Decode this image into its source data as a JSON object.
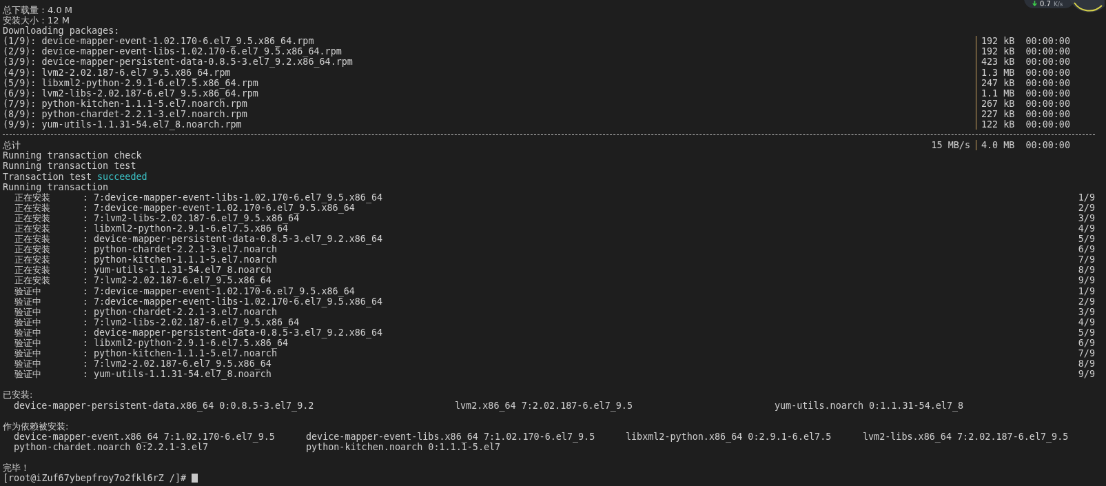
{
  "net_widget": {
    "speed": "0.7",
    "unit": "K/s"
  },
  "summary": [
    {
      "label": "总下载量：",
      "value": "4.0 M"
    },
    {
      "label": "安装大小：",
      "value": "12 M"
    }
  ],
  "download_header": "Downloading packages:",
  "downloads": [
    {
      "index": "(1/9):",
      "file": "device-mapper-event-1.02.170-6.el7_9.5.x86_64.rpm",
      "size": "192 kB",
      "time": "00:00:00"
    },
    {
      "index": "(2/9):",
      "file": "device-mapper-event-libs-1.02.170-6.el7_9.5.x86_64.rpm",
      "size": "192 kB",
      "time": "00:00:00"
    },
    {
      "index": "(3/9):",
      "file": "device-mapper-persistent-data-0.8.5-3.el7_9.2.x86_64.rpm",
      "size": "423 kB",
      "time": "00:00:00"
    },
    {
      "index": "(4/9):",
      "file": "lvm2-2.02.187-6.el7_9.5.x86_64.rpm",
      "size": "1.3 MB",
      "time": "00:00:00"
    },
    {
      "index": "(5/9):",
      "file": "libxml2-python-2.9.1-6.el7.5.x86_64.rpm",
      "size": "247 kB",
      "time": "00:00:00"
    },
    {
      "index": "(6/9):",
      "file": "lvm2-libs-2.02.187-6.el7_9.5.x86_64.rpm",
      "size": "1.1 MB",
      "time": "00:00:00"
    },
    {
      "index": "(7/9):",
      "file": "python-kitchen-1.1.1-5.el7.noarch.rpm",
      "size": "267 kB",
      "time": "00:00:00"
    },
    {
      "index": "(8/9):",
      "file": "python-chardet-2.2.1-3.el7.noarch.rpm",
      "size": "227 kB",
      "time": "00:00:00"
    },
    {
      "index": "(9/9):",
      "file": "yum-utils-1.1.31-54.el7_8.noarch.rpm",
      "size": "122 kB",
      "time": "00:00:00"
    }
  ],
  "total": {
    "label": "总计",
    "speed": "15 MB/s",
    "size": "4.0 MB",
    "time": "00:00:00"
  },
  "transaction_lines": [
    {
      "kind": "plain",
      "text": "Running transaction check"
    },
    {
      "kind": "plain",
      "text": "Running transaction test"
    },
    {
      "kind": "status",
      "text": "Transaction test",
      "status": "succeeded"
    },
    {
      "kind": "plain",
      "text": "Running transaction"
    }
  ],
  "steps": [
    {
      "action": "正在安装",
      "detail": ": 7:device-mapper-event-libs-1.02.170-6.el7_9.5.x86_64",
      "progress": "1/9"
    },
    {
      "action": "正在安装",
      "detail": ": 7:device-mapper-event-1.02.170-6.el7_9.5.x86_64",
      "progress": "2/9"
    },
    {
      "action": "正在安装",
      "detail": ": 7:lvm2-libs-2.02.187-6.el7_9.5.x86_64",
      "progress": "3/9"
    },
    {
      "action": "正在安装",
      "detail": ": libxml2-python-2.9.1-6.el7.5.x86_64",
      "progress": "4/9"
    },
    {
      "action": "正在安装",
      "detail": ": device-mapper-persistent-data-0.8.5-3.el7_9.2.x86_64",
      "progress": "5/9"
    },
    {
      "action": "正在安装",
      "detail": ": python-chardet-2.2.1-3.el7.noarch",
      "progress": "6/9"
    },
    {
      "action": "正在安装",
      "detail": ": python-kitchen-1.1.1-5.el7.noarch",
      "progress": "7/9"
    },
    {
      "action": "正在安装",
      "detail": ": yum-utils-1.1.31-54.el7_8.noarch",
      "progress": "8/9"
    },
    {
      "action": "正在安装",
      "detail": ": 7:lvm2-2.02.187-6.el7_9.5.x86_64",
      "progress": "9/9"
    },
    {
      "action": "验证中",
      "detail": ": 7:device-mapper-event-1.02.170-6.el7_9.5.x86_64",
      "progress": "1/9"
    },
    {
      "action": "验证中",
      "detail": ": 7:device-mapper-event-libs-1.02.170-6.el7_9.5.x86_64",
      "progress": "2/9"
    },
    {
      "action": "验证中",
      "detail": ": python-chardet-2.2.1-3.el7.noarch",
      "progress": "3/9"
    },
    {
      "action": "验证中",
      "detail": ": 7:lvm2-libs-2.02.187-6.el7_9.5.x86_64",
      "progress": "4/9"
    },
    {
      "action": "验证中",
      "detail": ": device-mapper-persistent-data-0.8.5-3.el7_9.2.x86_64",
      "progress": "5/9"
    },
    {
      "action": "验证中",
      "detail": ": libxml2-python-2.9.1-6.el7.5.x86_64",
      "progress": "6/9"
    },
    {
      "action": "验证中",
      "detail": ": python-kitchen-1.1.1-5.el7.noarch",
      "progress": "7/9"
    },
    {
      "action": "验证中",
      "detail": ": 7:lvm2-2.02.187-6.el7_9.5.x86_64",
      "progress": "8/9"
    },
    {
      "action": "验证中",
      "detail": ": yum-utils-1.1.31-54.el7_8.noarch",
      "progress": "9/9"
    }
  ],
  "installed": {
    "heading": "已安装:",
    "packages": [
      "device-mapper-persistent-data.x86_64 0:0.8.5-3.el7_9.2",
      "lvm2.x86_64 7:2.02.187-6.el7_9.5",
      "yum-utils.noarch 0:1.1.31-54.el7_8"
    ]
  },
  "dependencies": {
    "heading": "作为依赖被安装:",
    "packages": [
      "device-mapper-event.x86_64 7:1.02.170-6.el7_9.5",
      "device-mapper-event-libs.x86_64 7:1.02.170-6.el7_9.5",
      "libxml2-python.x86_64 0:2.9.1-6.el7.5",
      "lvm2-libs.x86_64 7:2.02.187-6.el7_9.5",
      "python-chardet.noarch 0:2.2.1-3.el7",
      "python-kitchen.noarch 0:1.1.1-5.el7"
    ]
  },
  "done": "完毕！",
  "prompt": "[root@iZuf67ybepfroy7o2fkl6rZ /]#"
}
